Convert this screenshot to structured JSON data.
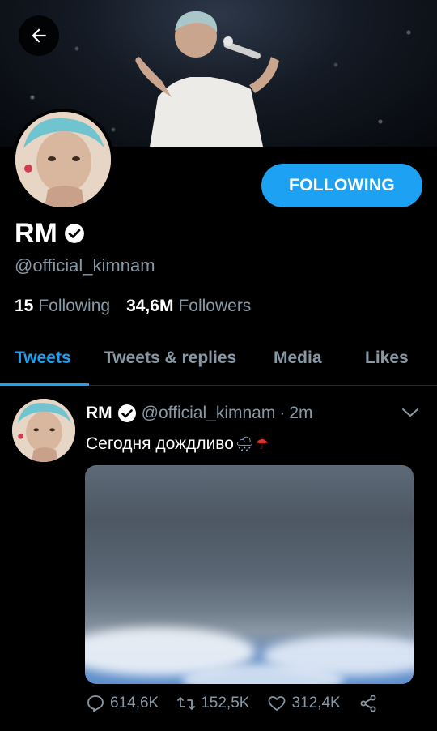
{
  "profile": {
    "name": "RM",
    "handle": "@official_kimnam",
    "following_count": "15",
    "following_label": "Following",
    "followers_count": "34,6M",
    "followers_label": "Followers",
    "follow_button_label": "FOLLOWING"
  },
  "tabs": [
    {
      "label": "Tweets",
      "active": true
    },
    {
      "label": "Tweets & replies",
      "active": false
    },
    {
      "label": "Media",
      "active": false
    },
    {
      "label": "Likes",
      "active": false
    }
  ],
  "tweet": {
    "name": "RM",
    "handle": "@official_kimnam",
    "separator": "·",
    "time": "2m",
    "text": "Сегодня дождливо",
    "emojis": [
      "🌧",
      "☂"
    ],
    "replies": "614,6K",
    "retweets": "152,5K",
    "likes": "312,4K"
  },
  "colors": {
    "accent": "#1da1f2",
    "muted": "#8899a6",
    "background": "#000000"
  },
  "icons": [
    "back-arrow-icon",
    "verified-icon",
    "chevron-down-icon",
    "reply-icon",
    "retweet-icon",
    "like-icon",
    "share-icon"
  ]
}
